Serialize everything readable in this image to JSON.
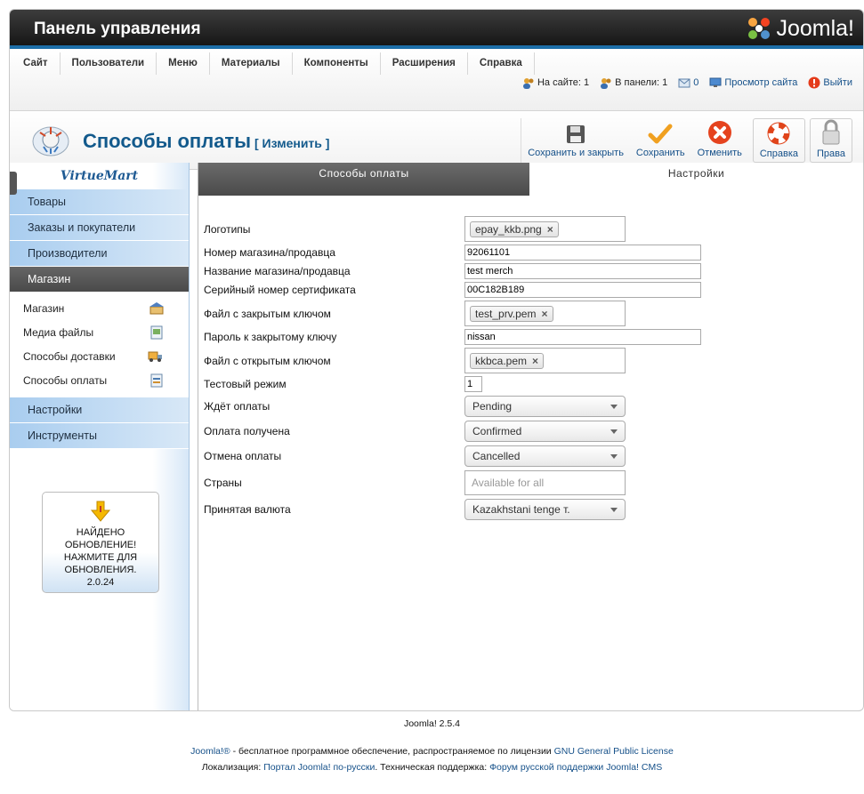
{
  "header": {
    "title": "Панель управления",
    "logo_text": "Joomla!"
  },
  "menu": [
    "Сайт",
    "Пользователи",
    "Меню",
    "Материалы",
    "Компоненты",
    "Расширения",
    "Справка"
  ],
  "status": {
    "on_site": "На сайте: 1",
    "in_panel": "В панели: 1",
    "messages": "0",
    "view_site": "Просмотр сайта",
    "logout": "Выйти"
  },
  "toolbar": {
    "title": "Способы оплаты",
    "edit": "[ Изменить ]",
    "save_close": "Сохранить и закрыть",
    "save": "Сохранить",
    "cancel": "Отменить",
    "help": "Справка",
    "rights": "Права"
  },
  "sidebar": {
    "logo": "VirtueMart",
    "sections_top": [
      "Товары",
      "Заказы и покупатели",
      "Производители",
      "Магазин"
    ],
    "sub_items": [
      "Магазин",
      "Медиа файлы",
      "Способы доставки",
      "Способы оплаты"
    ],
    "sections_bottom": [
      "Настройки",
      "Инструменты"
    ],
    "update": {
      "line1": "НАЙДЕНО",
      "line2": "ОБНОВЛЕНИЕ!",
      "line3": "НАЖМИТЕ ДЛЯ",
      "line4": "ОБНОВЛЕНИЯ.",
      "version": "2.0.24"
    }
  },
  "tabs": {
    "active": "Способы оплаты",
    "inactive": "Настройки"
  },
  "form": {
    "logos": {
      "label": "Логотипы",
      "value": "epay_kkb.png"
    },
    "shop_number": {
      "label": "Номер магазина/продавца",
      "value": "92061101"
    },
    "shop_name": {
      "label": "Название магазина/продавца",
      "value": "test merch"
    },
    "cert_serial": {
      "label": "Серийный номер сертификата",
      "value": "00C182B189"
    },
    "private_key_file": {
      "label": "Файл с закрытым ключом",
      "value": "test_prv.pem"
    },
    "private_key_password": {
      "label": "Пароль к закрытому ключу",
      "value": "nissan"
    },
    "public_key_file": {
      "label": "Файл с открытым ключом",
      "value": "kkbca.pem"
    },
    "test_mode": {
      "label": "Тестовый режим",
      "value": "1"
    },
    "awaiting": {
      "label": "Ждёт оплаты",
      "value": "Pending"
    },
    "received": {
      "label": "Оплата получена",
      "value": "Confirmed"
    },
    "cancelled": {
      "label": "Отмена оплаты",
      "value": "Cancelled"
    },
    "countries": {
      "label": "Страны",
      "placeholder": "Available for all"
    },
    "currency": {
      "label": "Принятая валюта",
      "value": "Kazakhstani tenge т."
    }
  },
  "footer": {
    "version": "Joomla! 2.5.4",
    "line1_a": "Joomla!®",
    "line1_b": " - бесплатное программное обеспечение, распространяемое по лицензии ",
    "line1_link": "GNU General Public License",
    "line2_a": "Локализация: ",
    "line2_link1": "Портал Joomla! по-русски",
    "line2_b": ". Техническая поддержка: ",
    "line2_link2": "Форум русской поддержки Joomla! CMS"
  }
}
